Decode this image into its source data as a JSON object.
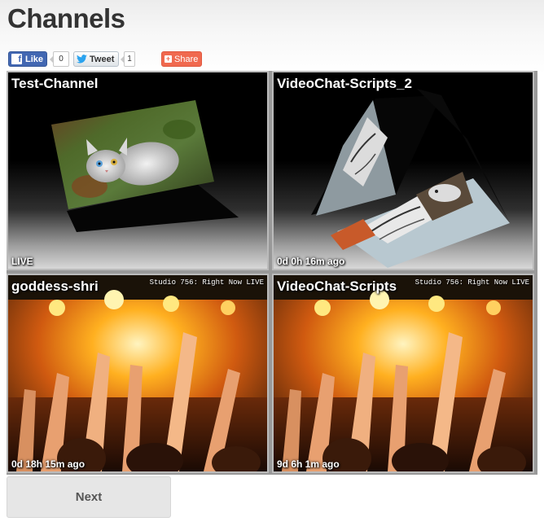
{
  "page": {
    "title": "Channels"
  },
  "social": {
    "like_label": "Like",
    "like_count": "0",
    "tweet_label": "Tweet",
    "tweet_count": "1",
    "share_label": "Share",
    "facebook_icon": "facebook-f-icon",
    "twitter_icon": "twitter-bird-icon",
    "share_icon": "plus-icon",
    "colors": {
      "facebook": "#4267b2",
      "twitter": "#2aa3ef",
      "share": "#f0694f"
    }
  },
  "channels": [
    {
      "name": "Test-Channel",
      "status": "LIVE",
      "thumbnail": "rotating-cube-cat-image"
    },
    {
      "name": "VideoChat-Scripts_2",
      "status": "0d 0h 16m ago",
      "thumbnail": "rotating-cube-cat-drawings"
    },
    {
      "name": "goddess-shri",
      "status": "0d 18h 15m ago",
      "thumbnail": "concert-crowd-image",
      "watermark": "Studio 756: Right Now LIVE"
    },
    {
      "name": "VideoChat-Scripts",
      "status": "9d 6h 1m ago",
      "thumbnail": "concert-crowd-image",
      "watermark": "Studio 756: Right Now LIVE"
    }
  ],
  "pagination": {
    "next_label": "Next"
  }
}
